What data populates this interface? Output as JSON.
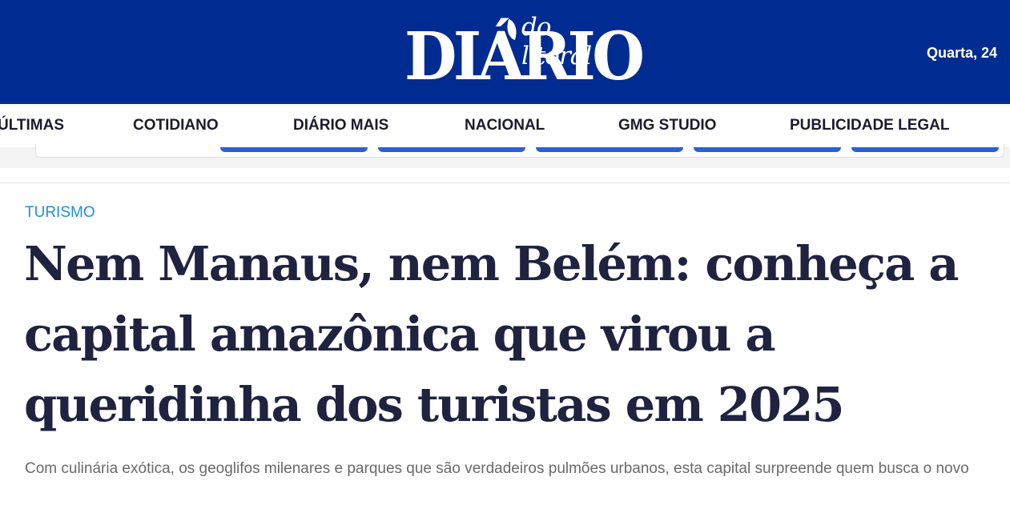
{
  "header": {
    "logo_main": "DIÁRIO",
    "logo_sub": "do litoral",
    "date": "Quarta, 24"
  },
  "nav": {
    "items": [
      "ÚLTIMAS",
      "COTIDIANO",
      "DIÁRIO MAIS",
      "NACIONAL",
      "GMG STUDIO",
      "PUBLICIDADE LEGAL"
    ]
  },
  "article": {
    "category": "TURISMO",
    "headline": "Nem Manaus, nem Belém: conheça a capital amazônica que virou a queridinha dos turistas em 2025",
    "subtitle": "Com culinária exótica, os geoglifos milenares e parques que são verdadeiros pulmões urbanos, esta capital surpreende quem busca o novo"
  },
  "colors": {
    "header_bg": "#002c91",
    "headline": "#1f2340",
    "category": "#1e8fde",
    "subtitle": "#6a6a6a"
  }
}
